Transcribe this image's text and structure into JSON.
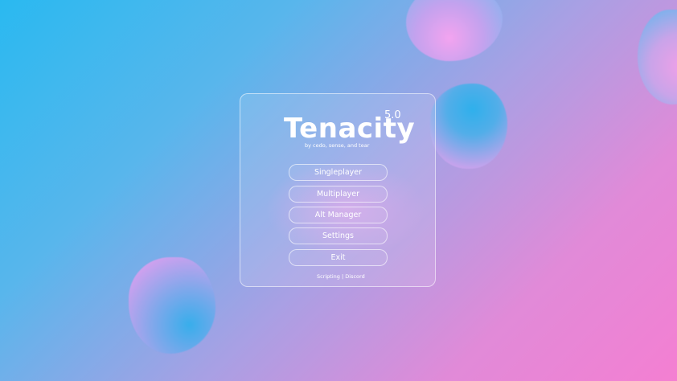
{
  "app": {
    "title": "Tenacity",
    "version": "5.0",
    "subtitle": "by cedo, sense, and tear"
  },
  "menu": {
    "buttons": [
      {
        "label": "Singleplayer"
      },
      {
        "label": "Multiplayer"
      },
      {
        "label": "Alt Manager"
      },
      {
        "label": "Settings"
      },
      {
        "label": "Exit"
      }
    ]
  },
  "footer": {
    "scripting": "Scripting",
    "separator": "|",
    "discord": "Discord"
  },
  "colors": {
    "background_start": "#2ab9f0",
    "background_end": "#f47fd2",
    "text": "#ffffff"
  }
}
